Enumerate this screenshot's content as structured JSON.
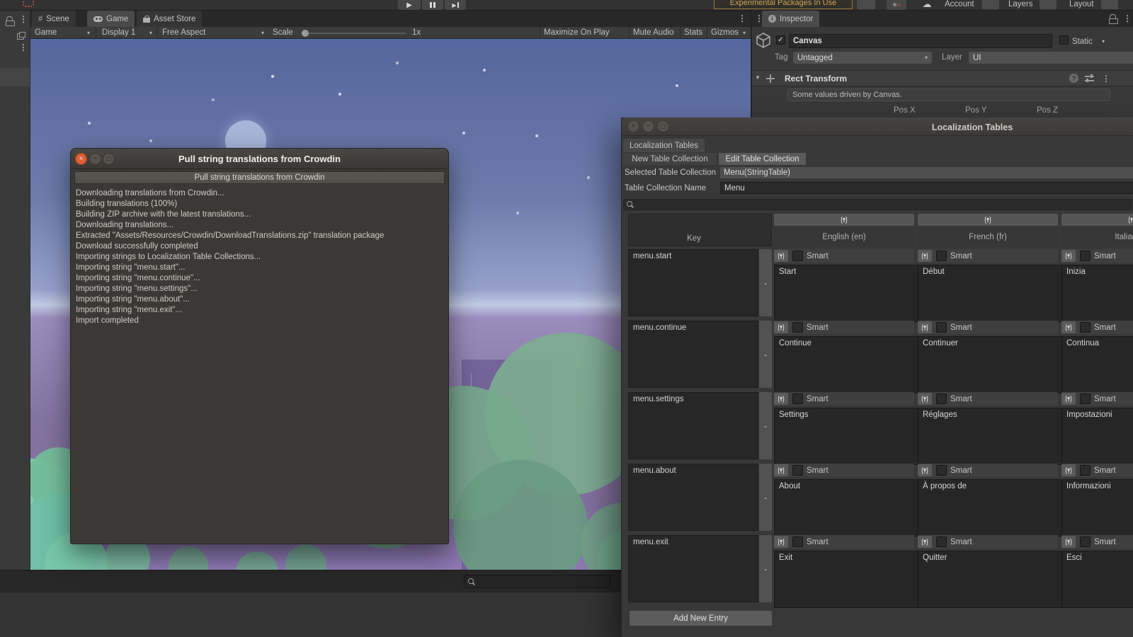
{
  "toolbar": {
    "experimental_badge": "Experimental Packages In Use",
    "account_label": "Account",
    "layers_label": "Layers",
    "layout_label": "Layout"
  },
  "editor_tabs": {
    "scene": "Scene",
    "game": "Game",
    "asset_store": "Asset Store"
  },
  "game_toolbar": {
    "display_target": "Game",
    "display": "Display 1",
    "aspect": "Free Aspect",
    "scale_label": "Scale",
    "scale_value": "1x",
    "maximize": "Maximize On Play",
    "mute": "Mute Audio",
    "stats": "Stats",
    "gizmos": "Gizmos"
  },
  "inspector": {
    "tab": "Inspector",
    "object_name": "Canvas",
    "static_label": "Static",
    "tag_label": "Tag",
    "tag_value": "Untagged",
    "layer_label": "Layer",
    "layer_value": "UI",
    "component": "Rect Transform",
    "helpbox": "Some values driven by Canvas.",
    "pos_x": "Pos X",
    "pos_y": "Pos Y",
    "pos_z": "Pos Z"
  },
  "dialog": {
    "title": "Pull string translations from Crowdin",
    "action_button": "Pull string translations from Crowdin",
    "log": [
      "Downloading translations from Crowdin...",
      "Building translations (100%)",
      "Building ZIP archive with the latest translations...",
      "Downloading translations...",
      "Extracted \"Assets/Resources/Crowdin/DownloadTranslations.zip\" translation package",
      "Download successfully completed",
      "Importing strings to Localization Table Collections...",
      "Importing string \"menu.start\"...",
      "Importing string \"menu.continue\"...",
      "Importing string \"menu.settings\"...",
      "Importing string \"menu.about\"...",
      "Importing string \"menu.exit\"...",
      "Import completed"
    ]
  },
  "locwin": {
    "title": "Localization Tables",
    "tab": "Localization Tables",
    "new_btn": "New Table Collection",
    "edit_btn": "Edit Table Collection",
    "selected_label": "Selected Table Collection",
    "selected_value": "Menu(StringTable)",
    "name_label": "Table Collection Name",
    "name_value": "Menu",
    "key_header": "Key",
    "columns": [
      "English (en)",
      "French (fr)",
      "Italian (it)"
    ],
    "smart_label": "Smart",
    "remove_label": "-",
    "add_btn": "Add New Entry",
    "rows": [
      {
        "key": "menu.start",
        "en": "Start",
        "fr": "Début",
        "it": "Inizia"
      },
      {
        "key": "menu.continue",
        "en": "Continue",
        "fr": "Continuer",
        "it": "Continua"
      },
      {
        "key": "menu.settings",
        "en": "Settings",
        "fr": "Réglages",
        "it": "Impostazioni"
      },
      {
        "key": "menu.about",
        "en": "About",
        "fr": "À propos de",
        "it": "Informazioni"
      },
      {
        "key": "menu.exit",
        "en": "Exit",
        "fr": "Quitter",
        "it": "Esci"
      }
    ]
  },
  "icons": {
    "play": "▶",
    "caret": "▾",
    "foldout": "▼",
    "kebab": "⋮",
    "check": "✓",
    "cloud": "☁",
    "help": "?",
    "info": "i",
    "hash": "#",
    "close": "×",
    "minus_glyph": "−",
    "square": "▢"
  },
  "colors": {
    "accent_orange": "#cf9c4e",
    "focus_blue": "#4c70ab",
    "close_button_orange": "#dd5f37",
    "bush_green": "#7aaa8c",
    "bush_teal": "#7cc9aa",
    "sky_top": "#55669d",
    "ground_purple": "#80719f"
  }
}
